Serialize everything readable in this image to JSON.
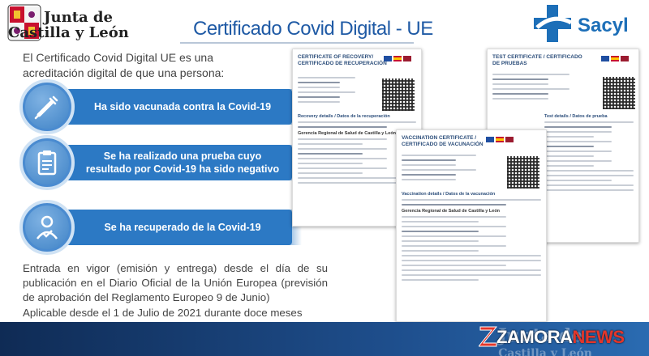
{
  "header": {
    "logo_left_line1": "Junta de",
    "logo_left_line2": "Castilla y León",
    "title": "Certificado Covid Digital - UE",
    "logo_right": "Sacyl"
  },
  "intro": "El Certificado Covid Digital UE es una acreditación digital de que una persona:",
  "bands": [
    {
      "label": "Ha sido vacunada contra la Covid-19",
      "icon": "syringe-icon"
    },
    {
      "label": "Se ha realizado una prueba cuyo resultado por Covid-19 ha sido negativo",
      "icon": "test-clipboard-icon"
    },
    {
      "label": "Se ha recuperado de la Covid-19",
      "icon": "recovered-person-icon"
    }
  ],
  "entrada": "Entrada en vigor (emisión y entrega) desde el día de su publicación en el Diario Oficial de la Unión Europea (previsión de aprobación del Reglamento Europeo 9 de Junio)",
  "aplicable": "Aplicable desde el 1 de Julio de 2021 durante doce meses",
  "certificates": {
    "recovery": {
      "title": "CERTIFICATE OF RECOVERY/ CERTIFICADO DE RECUPERACIÓN",
      "section": "Recovery details / Datos de la recuperación",
      "issuer": "Gerencia Regional de Salud de Castilla y León"
    },
    "test": {
      "title": "TEST CERTIFICATE / CERTIFICADO DE PRUEBAS",
      "section": "Test details / Datos de prueba"
    },
    "vaccination": {
      "title": "VACCINATION CERTIFICATE / CERTIFICADO DE VACUNACIÓN",
      "section": "Vaccination details / Datos de la vacunación",
      "issuer": "Gerencia Regional de Salud de Castilla y León"
    }
  },
  "footer": {
    "brand_left": "ZAMORA",
    "brand_right": "NEWS",
    "junta_watermark_line1": "Junta de",
    "junta_watermark_line2": "Castilla y León"
  },
  "colors": {
    "band_blue": "#2c79c4",
    "title_blue": "#1f5aa5",
    "banner_dark": "#0f2b55",
    "news_red": "#e2362b"
  }
}
